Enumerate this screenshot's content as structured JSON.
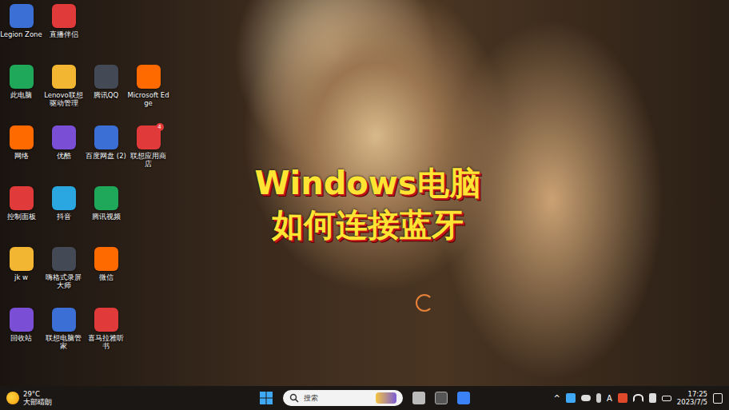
{
  "desktop": {
    "icon_rows": [
      [
        {
          "label": "Legion Zone"
        },
        {
          "label": "直播伴侣"
        }
      ],
      [
        {
          "label": "此电脑"
        },
        {
          "label": "Lenovo联想驱动管理"
        },
        {
          "label": "腾讯QQ"
        },
        {
          "label": "Microsoft Edge"
        }
      ],
      [
        {
          "label": "网络"
        },
        {
          "label": "优酷"
        },
        {
          "label": "百度网盘 (2)"
        },
        {
          "label": "联想应用商店",
          "badge": "4"
        }
      ],
      [
        {
          "label": "控制面板"
        },
        {
          "label": "抖音"
        },
        {
          "label": "腾讯视频"
        }
      ],
      [
        {
          "label": "jk w"
        },
        {
          "label": "嗨格式录屏大师"
        },
        {
          "label": "微信"
        }
      ],
      [
        {
          "label": "回收站"
        },
        {
          "label": "联想电脑管家"
        },
        {
          "label": "喜马拉雅听书"
        }
      ]
    ]
  },
  "caption": {
    "lines": [
      "Windows电脑",
      "如何连接蓝牙"
    ]
  },
  "taskbar": {
    "weather": {
      "temp": "29°C",
      "desc": "大部晴朗"
    },
    "search": {
      "placeholder": "搜索"
    },
    "tray": {
      "overflow": "^",
      "ime": "A",
      "time": "17:25",
      "date": "2023/7/5"
    }
  }
}
